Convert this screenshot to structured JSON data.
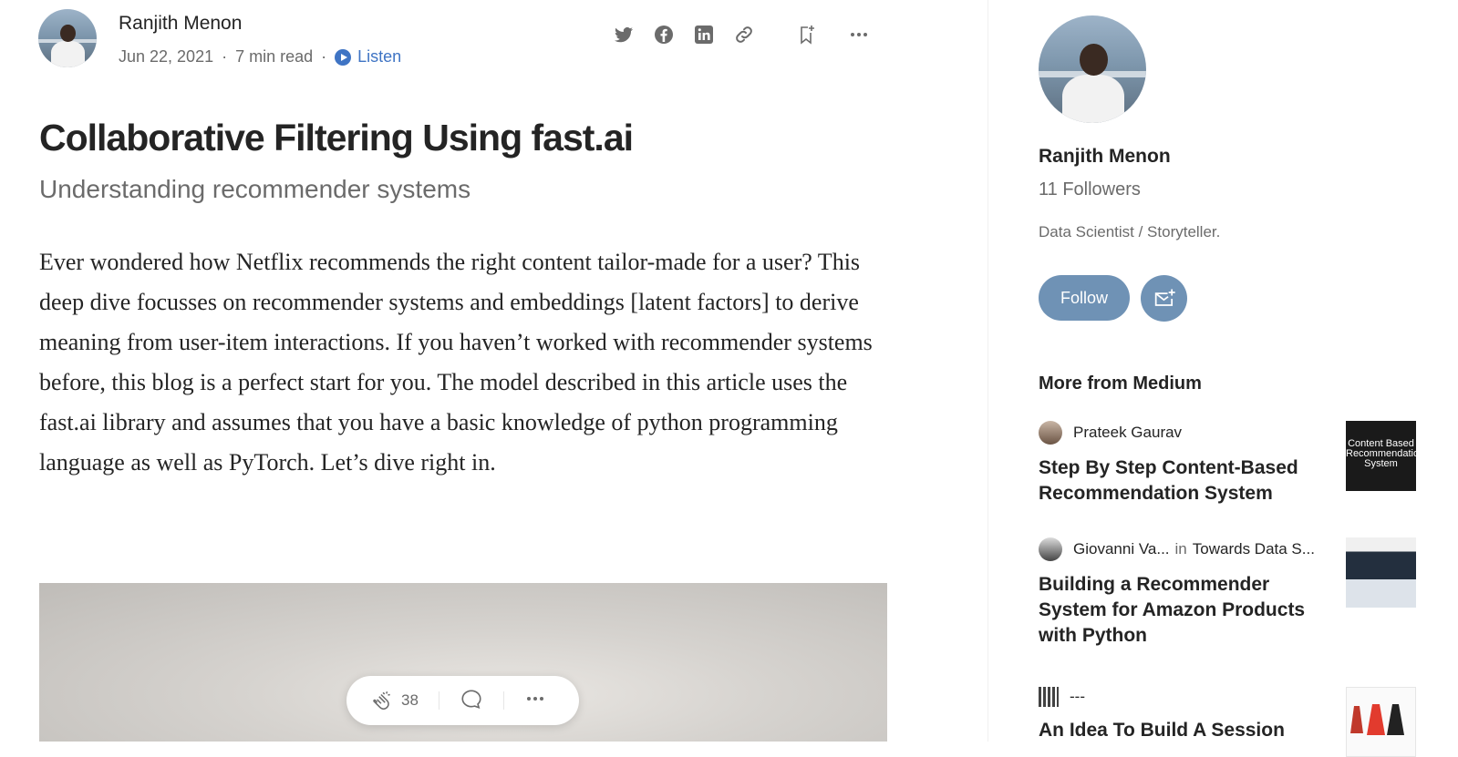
{
  "author": {
    "name": "Ranjith Menon",
    "date": "Jun 22, 2021",
    "read_time": "7 min read",
    "separator": "·",
    "listen_label": "Listen"
  },
  "top_icons": [
    "twitter-icon",
    "facebook-icon",
    "linkedin-icon",
    "link-icon",
    "bookmark-add-icon",
    "more-icon"
  ],
  "article": {
    "title": "Collaborative Filtering Using fast.ai",
    "subtitle": "Understanding recommender systems",
    "intro": "Ever wondered how Netflix recommends the right content tailor-made for a user? This deep dive focusses on recommender systems and embeddings [latent factors] to derive meaning from user-item interactions. If you haven’t worked with recommender systems before, this blog is a perfect start for you. The model described in this article uses the fast.ai library and assumes that you have a basic knowledge of python programming language as well as PyTorch. Let’s dive right in."
  },
  "action_bar": {
    "clap_count": "38"
  },
  "sidebar": {
    "name": "Ranjith Menon",
    "followers": "11 Followers",
    "bio": "Data Scientist / Storyteller.",
    "follow_label": "Follow",
    "more_heading": "More from Medium",
    "recommendations": [
      {
        "author": "Prateek Gaurav",
        "publication": "",
        "title": "Step By Step Content-Based Recommendation System",
        "thumb_text": "Content Based Recommendation System"
      },
      {
        "author": "Giovanni Va...",
        "in_label": "in",
        "publication": "Towards Data S...",
        "title": "Building a Recommender System for Amazon Products with Python"
      },
      {
        "author": "---",
        "title": "An Idea To Build A Session"
      }
    ]
  },
  "colors": {
    "accent": "#3f74c4",
    "follow_button": "#6f92b5",
    "text": "#242424",
    "muted": "#6b6b6b"
  }
}
